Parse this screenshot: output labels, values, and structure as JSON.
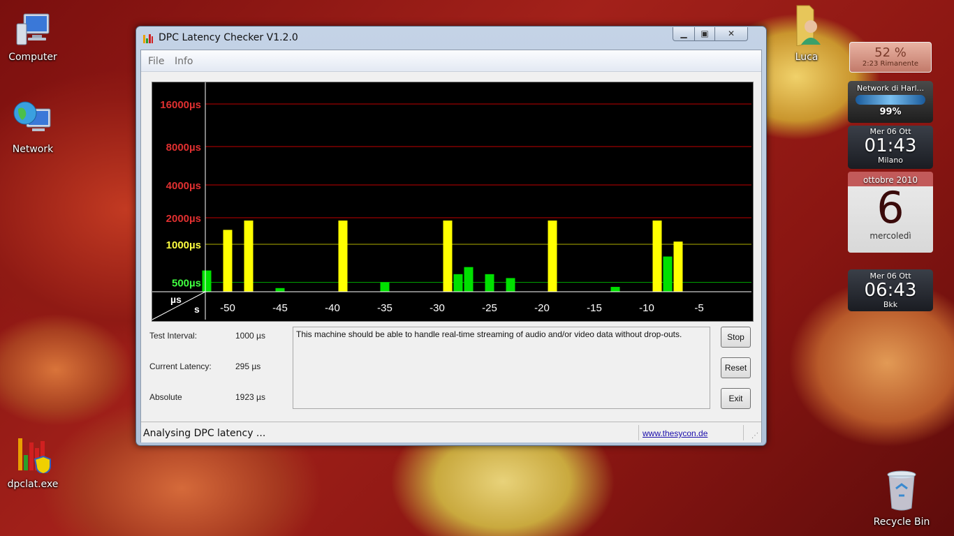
{
  "desktop": {
    "icons": [
      {
        "label": "Computer",
        "icon": "computer-icon"
      },
      {
        "label": "Network",
        "icon": "network-icon"
      },
      {
        "label": "dpclat.exe",
        "icon": "dpclat-app-icon"
      },
      {
        "label": "Luca",
        "icon": "user-folder-icon"
      },
      {
        "label": "Recycle Bin",
        "icon": "recycle-bin-icon"
      }
    ]
  },
  "gadgets": {
    "battery": {
      "percent": "52 %",
      "remaining": "2:23 Rimanente"
    },
    "network": {
      "name": "Network di Harl...",
      "signal": "99%"
    },
    "clock1": {
      "date": "Mer 06 Ott",
      "time": "01:43",
      "city": "Milano"
    },
    "calendar": {
      "month": "ottobre 2010",
      "day": "6",
      "weekday": "mercoledì"
    },
    "clock2": {
      "date": "Mer 06 Ott",
      "time": "06:43",
      "city": "Bkk"
    }
  },
  "window": {
    "title": "DPC Latency Checker V1.2.0",
    "menu": [
      "File",
      "Info"
    ],
    "fields": {
      "test_interval_label": "Test Interval:",
      "test_interval_value": "1000 µs",
      "current_latency_label": "Current Latency:",
      "current_latency_value": "295 µs",
      "absolute_label": "Absolute",
      "absolute_value": "1923 µs"
    },
    "message": "This machine should be able to handle real-time streaming of audio and/or video data without drop-outs.",
    "buttons": {
      "stop": "Stop",
      "reset": "Reset",
      "exit": "Exit"
    },
    "status": "Analysing DPC latency ...",
    "link": "www.thesycon.de"
  },
  "colors": {
    "green_bar": "#00e000",
    "yellow_bar": "#ffff00",
    "red_grid": "#c00000",
    "chart_bg": "#000000"
  },
  "chart_data": {
    "type": "bar",
    "y_scale": "log2",
    "y_ticks": [
      {
        "label": "16000µs",
        "value": 16000,
        "color": "#e03030"
      },
      {
        "label": "8000µs",
        "value": 8000,
        "color": "#e03030"
      },
      {
        "label": "4000µs",
        "value": 4000,
        "color": "#e03030"
      },
      {
        "label": "2000µs",
        "value": 2000,
        "color": "#e03030"
      },
      {
        "label": "1000µs",
        "value": 1000,
        "color": "#ffff40"
      },
      {
        "label": "500µs",
        "value": 500,
        "color": "#40ff40"
      }
    ],
    "x_unit_label": "s",
    "y_unit_label": "µs",
    "x_ticks": [
      {
        "label": "-50",
        "value": -50
      },
      {
        "label": "-45",
        "value": -45
      },
      {
        "label": "-40",
        "value": -40
      },
      {
        "label": "-35",
        "value": -35
      },
      {
        "label": "-30",
        "value": -30
      },
      {
        "label": "-25",
        "value": -25
      },
      {
        "label": "-20",
        "value": -20
      },
      {
        "label": "-15",
        "value": -15
      },
      {
        "label": "-10",
        "value": -10
      },
      {
        "label": "-5",
        "value": -5
      }
    ],
    "x": [
      -52,
      -51,
      -50,
      -49,
      -48,
      -47,
      -46,
      -45,
      -44,
      -43,
      -42,
      -41,
      -40,
      -39,
      -38,
      -37,
      -36,
      -35,
      -34,
      -33,
      -32,
      -31,
      -30,
      -29,
      -28,
      -27,
      -26,
      -25,
      -24,
      -23,
      -22,
      -21,
      -20,
      -19,
      -18,
      -17,
      -16,
      -15,
      -14,
      -13,
      -12,
      -11,
      -10,
      -9,
      -8,
      -7,
      -6,
      -5,
      -4,
      -3,
      -2,
      -1
    ],
    "values": [
      620,
      360,
      1300,
      260,
      1923,
      340,
      340,
      450,
      380,
      380,
      380,
      320,
      280,
      1923,
      310,
      340,
      340,
      500,
      360,
      350,
      330,
      280,
      380,
      1923,
      580,
      660,
      390,
      580,
      330,
      540,
      280,
      340,
      400,
      1923,
      320,
      330,
      350,
      420,
      360,
      460,
      350,
      420,
      400,
      1923,
      800,
      1050,
      380,
      350,
      380,
      340,
      310,
      390
    ],
    "thresholds": {
      "green_max": 1000,
      "yellow_max": 2000
    }
  }
}
